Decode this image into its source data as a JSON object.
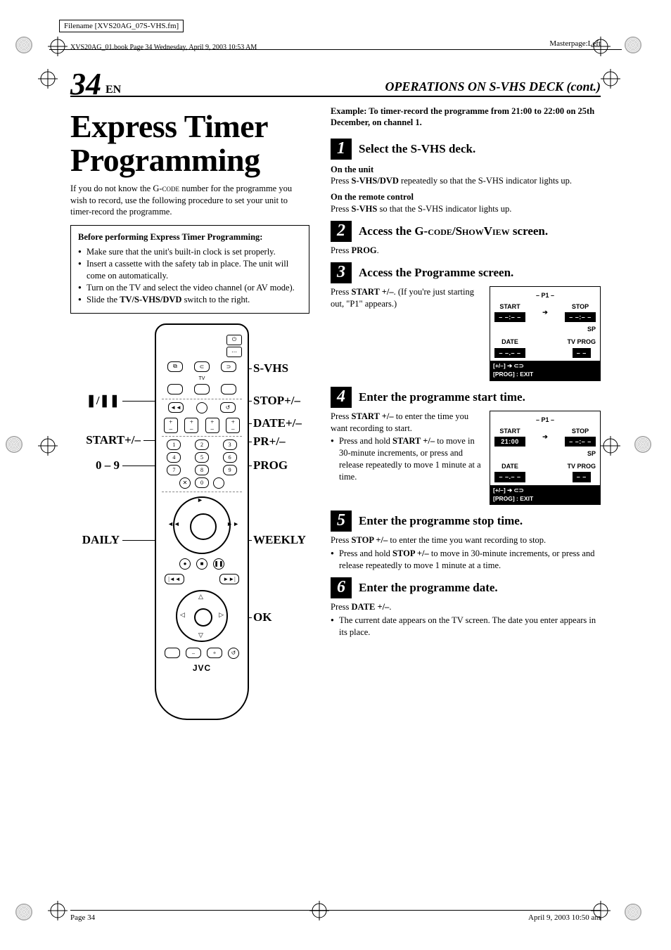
{
  "meta": {
    "filename_line": "Filename [XVS20AG_07S-VHS.fm]",
    "masterpage": "Masterpage:Left",
    "book_line": "XVS20AG_01.book  Page 34  Wednesday, April 9, 2003  10:53 AM",
    "footer_left": "Page 34",
    "footer_right": "April 9, 2003 10:50 am"
  },
  "header": {
    "page_num": "34",
    "page_lang": "EN",
    "section": "OPERATIONS ON S-VHS DECK (cont.)"
  },
  "left": {
    "title": "Express Timer Programming",
    "intro_pre": "If you do not know the ",
    "intro_gcode": "G-code",
    "intro_post": " number for the programme you wish to record, use the following procedure to set your unit to timer-record the programme.",
    "box_title": "Before performing Express Timer Programming:",
    "box_items": [
      "Make sure that the unit's built-in clock is set properly.",
      "Insert a cassette with the safety tab in place. The unit will come on automatically.",
      "Turn on the TV and select the video channel (or AV mode).",
      "Slide the TV/S-VHS/DVD switch to the right."
    ],
    "box_item_3_pre": "Slide the ",
    "box_item_3_bold": "TV/S-VHS/DVD",
    "box_item_3_post": " switch to the right.",
    "callouts": {
      "svhs": "S-VHS",
      "stop_pm": "STOP+/–",
      "date_pm": "DATE+/–",
      "pr_pm": "PR+/–",
      "prog": "PROG",
      "weekly": "WEEKLY",
      "ok": "OK",
      "pause": "❚/❚❚",
      "start_pm": "START+/–",
      "zero_nine": "0 – 9",
      "daily": "DAILY"
    },
    "brand": "JVC",
    "tv_label": "TV"
  },
  "right": {
    "example": "Example: To timer-record the programme from 21:00 to 22:00 on 25th December, on channel 1.",
    "steps": [
      {
        "n": "1",
        "title": "Select the S-VHS deck.",
        "unit_hdr": "On the unit",
        "unit_text_pre": "Press ",
        "unit_text_bold": "S-VHS/DVD",
        "unit_text_post": " repeatedly so that the S-VHS indicator lights up.",
        "remote_hdr": "On the remote control",
        "remote_text_pre": "Press ",
        "remote_text_bold": "S-VHS",
        "remote_text_post": " so that the S-VHS indicator lights up."
      },
      {
        "n": "2",
        "title_pre": "Access the ",
        "title_gcode": "G-code/ShowView",
        "title_post": " screen.",
        "body_pre": "Press ",
        "body_bold": "PROG",
        "body_post": "."
      },
      {
        "n": "3",
        "title": "Access the Programme screen.",
        "body_pre": "Press ",
        "body_bold": "START +/–",
        "body_post": ". (If you're just starting out, \"P1\" appears.)"
      },
      {
        "n": "4",
        "title": "Enter the programme start time.",
        "body_pre": "Press ",
        "body_bold": "START +/–",
        "body_post": " to enter the time you want recording to start.",
        "bullet_pre": "Press and hold ",
        "bullet_bold": "START +/–",
        "bullet_post": " to move in 30-minute increments, or press and release repeatedly to move 1 minute at a time."
      },
      {
        "n": "5",
        "title": "Enter the programme stop time.",
        "body_pre": "Press ",
        "body_bold": "STOP +/–",
        "body_post": " to enter the time you want recording to stop.",
        "bullet_pre": "Press and hold ",
        "bullet_bold": "STOP +/–",
        "bullet_post": " to move in 30-minute increments, or press and release repeatedly to move 1 minute at a time."
      },
      {
        "n": "6",
        "title": "Enter the programme date.",
        "body_pre": "Press ",
        "body_bold": "DATE +/–",
        "body_post": ".",
        "bullet": "The current date appears on the TV screen. The date you enter appears in its place."
      }
    ],
    "osd": {
      "p1": "– P1 –",
      "start": "START",
      "stop": "STOP",
      "date": "DATE",
      "tvprog": "TV PROG",
      "sp": "SP",
      "dashes_time": "– –:– –",
      "dashes_date": "– –.– –",
      "dashes_prog": "– –",
      "start_time": "21:00",
      "foot1": "[+/–] ➔ ⊂⊃",
      "foot2": "[PROG] : EXIT"
    }
  }
}
